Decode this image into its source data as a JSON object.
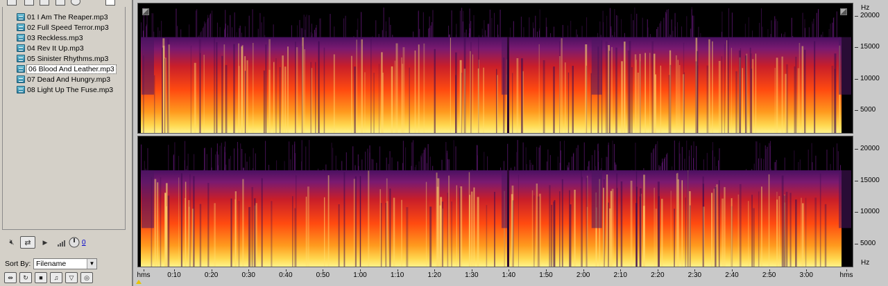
{
  "files": [
    {
      "name": "01 I Am The Reaper.mp3",
      "selected": false
    },
    {
      "name": "02 Full Speed Terror.mp3",
      "selected": false
    },
    {
      "name": "03 Reckless.mp3",
      "selected": false
    },
    {
      "name": "04 Rev It Up.mp3",
      "selected": false
    },
    {
      "name": "05 Sinister Rhythms.mp3",
      "selected": false
    },
    {
      "name": "06 Blood And Leather.mp3",
      "selected": true
    },
    {
      "name": "07 Dead And Hungry.mp3",
      "selected": false
    },
    {
      "name": "08 Light Up The Fuse.mp3",
      "selected": false
    }
  ],
  "transport": {
    "volume_value": "0"
  },
  "sort": {
    "label": "Sort By:",
    "value": "Filename"
  },
  "view": {
    "hz_unit": "Hz",
    "hz_labels": [
      "20000",
      "15000",
      "10000",
      "5000"
    ],
    "time_unit": "hms",
    "time_labels": [
      "0:10",
      "0:20",
      "0:30",
      "0:40",
      "0:50",
      "1:00",
      "1:10",
      "1:20",
      "1:30",
      "1:40",
      "1:50",
      "2:00",
      "2:10",
      "2:20",
      "2:30",
      "2:40",
      "2:50",
      "3:00"
    ]
  },
  "colors": {
    "background": "#d4d0c8",
    "spectrum_low": "#fff07a",
    "spectrum_mid": "#ff5a10",
    "spectrum_high": "#9a1a7a",
    "spectrum_void": "#000000"
  },
  "icons": [
    "open-icon",
    "cut-icon",
    "grid-icon",
    "save-icon",
    "info-icon",
    "mute-icon",
    "loop-icon",
    "play-icon",
    "volume-icon",
    "knob-icon",
    "sort-arrow-icon",
    "tool-icon"
  ]
}
